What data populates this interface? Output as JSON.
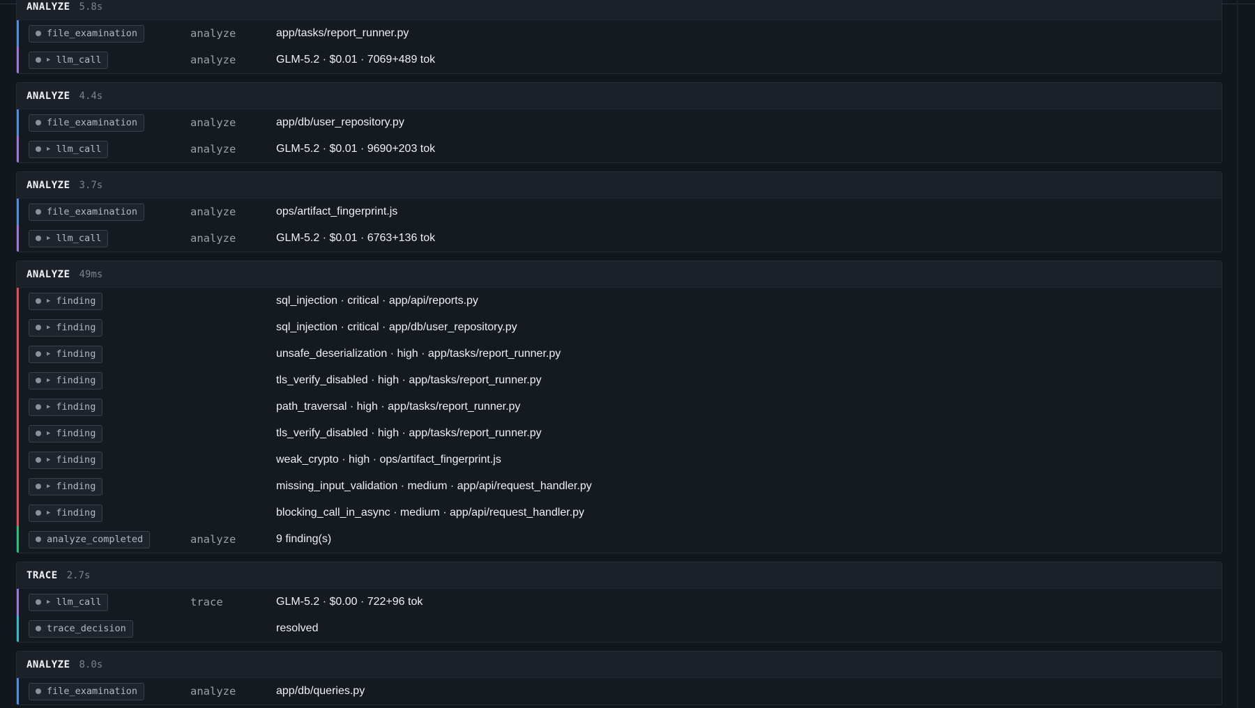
{
  "groups": [
    {
      "title": "ANALYZE",
      "duration": "5.8s",
      "rows": [
        {
          "event": "file_examination",
          "expandable": false,
          "phase": "analyze",
          "desc": "app/tasks/report_runner.py",
          "color": "blue"
        },
        {
          "event": "llm_call",
          "expandable": true,
          "phase": "analyze",
          "desc": "GLM-5.2 · $0.01 · 7069+489 tok",
          "color": "purple"
        }
      ]
    },
    {
      "title": "ANALYZE",
      "duration": "4.4s",
      "rows": [
        {
          "event": "file_examination",
          "expandable": false,
          "phase": "analyze",
          "desc": "app/db/user_repository.py",
          "color": "blue"
        },
        {
          "event": "llm_call",
          "expandable": true,
          "phase": "analyze",
          "desc": "GLM-5.2 · $0.01 · 9690+203 tok",
          "color": "purple"
        }
      ]
    },
    {
      "title": "ANALYZE",
      "duration": "3.7s",
      "rows": [
        {
          "event": "file_examination",
          "expandable": false,
          "phase": "analyze",
          "desc": "ops/artifact_fingerprint.js",
          "color": "blue"
        },
        {
          "event": "llm_call",
          "expandable": true,
          "phase": "analyze",
          "desc": "GLM-5.2 · $0.01 · 6763+136 tok",
          "color": "purple"
        }
      ]
    },
    {
      "title": "ANALYZE",
      "duration": "49ms",
      "rows": [
        {
          "event": "finding",
          "expandable": true,
          "phase": "",
          "desc": "sql_injection · critical · app/api/reports.py",
          "color": "red"
        },
        {
          "event": "finding",
          "expandable": true,
          "phase": "",
          "desc": "sql_injection · critical · app/db/user_repository.py",
          "color": "red"
        },
        {
          "event": "finding",
          "expandable": true,
          "phase": "",
          "desc": "unsafe_deserialization · high · app/tasks/report_runner.py",
          "color": "red"
        },
        {
          "event": "finding",
          "expandable": true,
          "phase": "",
          "desc": "tls_verify_disabled · high · app/tasks/report_runner.py",
          "color": "red"
        },
        {
          "event": "finding",
          "expandable": true,
          "phase": "",
          "desc": "path_traversal · high · app/tasks/report_runner.py",
          "color": "red"
        },
        {
          "event": "finding",
          "expandable": true,
          "phase": "",
          "desc": "tls_verify_disabled · high · app/tasks/report_runner.py",
          "color": "red"
        },
        {
          "event": "finding",
          "expandable": true,
          "phase": "",
          "desc": "weak_crypto · high · ops/artifact_fingerprint.js",
          "color": "red"
        },
        {
          "event": "finding",
          "expandable": true,
          "phase": "",
          "desc": "missing_input_validation · medium · app/api/request_handler.py",
          "color": "red"
        },
        {
          "event": "finding",
          "expandable": true,
          "phase": "",
          "desc": "blocking_call_in_async · medium · app/api/request_handler.py",
          "color": "red"
        },
        {
          "event": "analyze_completed",
          "expandable": false,
          "phase": "analyze",
          "desc": "9 finding(s)",
          "color": "green"
        }
      ]
    },
    {
      "title": "TRACE",
      "duration": "2.7s",
      "rows": [
        {
          "event": "llm_call",
          "expandable": true,
          "phase": "trace",
          "desc": "GLM-5.2 · $0.00 · 722+96 tok",
          "color": "purple"
        },
        {
          "event": "trace_decision",
          "expandable": false,
          "phase": "",
          "desc": "resolved",
          "color": "cyan"
        }
      ]
    },
    {
      "title": "ANALYZE",
      "duration": "8.0s",
      "rows": [
        {
          "event": "file_examination",
          "expandable": false,
          "phase": "analyze",
          "desc": "app/db/queries.py",
          "color": "blue"
        }
      ]
    }
  ]
}
